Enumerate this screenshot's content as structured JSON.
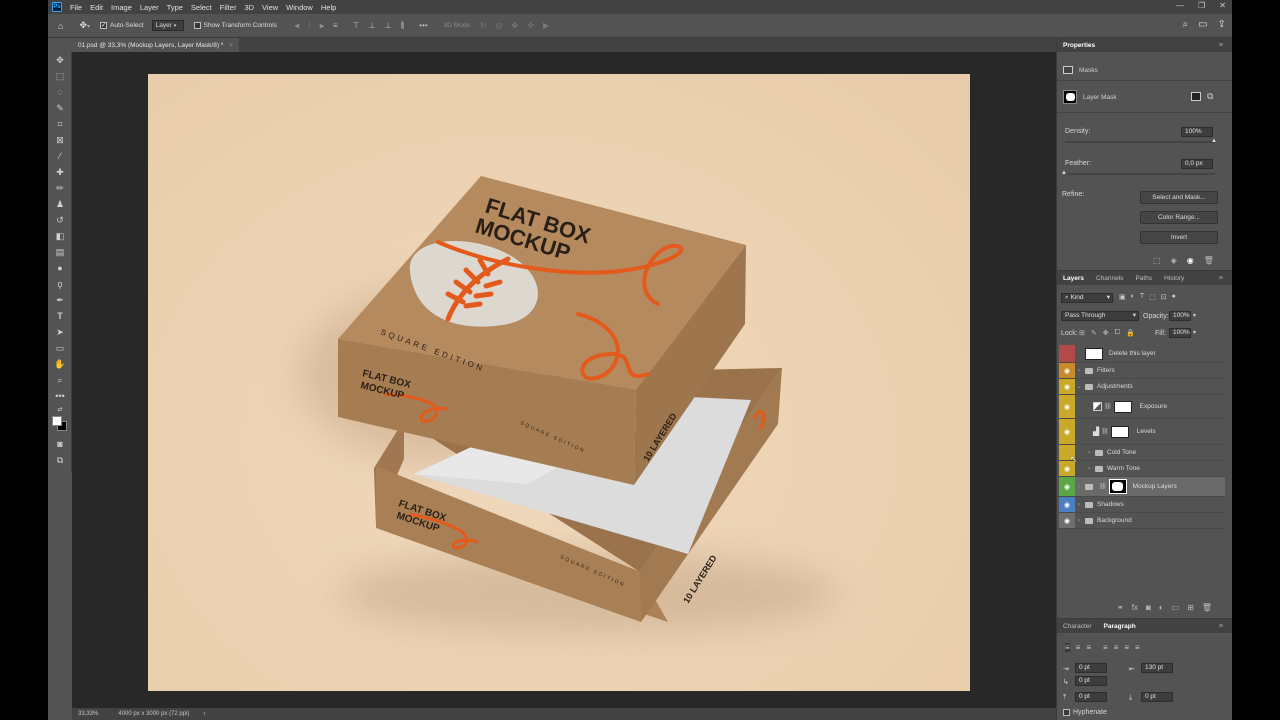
{
  "menubar": {
    "logo": "Ps",
    "items": [
      "File",
      "Edit",
      "Image",
      "Layer",
      "Type",
      "Select",
      "Filter",
      "3D",
      "View",
      "Window",
      "Help"
    ],
    "window_controls": [
      "—",
      "❐",
      "✕"
    ]
  },
  "options_bar": {
    "auto_select_label": "Auto-Select",
    "auto_select_checked": true,
    "target_value": "Layer",
    "show_transform_label": "Show Transform Controls",
    "mode_3d_label": "3D Mode:"
  },
  "document": {
    "tab_title": "01.psd @ 33,3% (Mockup Layers, Layer Mask/8) *",
    "close_glyph": "×"
  },
  "status": {
    "zoom": "33,33%",
    "doc_size": "4000 px x 3000 px (72 ppi)"
  },
  "box_art": {
    "title_line1": "FLAT BOX",
    "title_line2": "MOCKUP",
    "edition": "SQUARE EDITION",
    "side_text": "10 LAYERED"
  },
  "properties": {
    "tab": "Properties",
    "section": "Masks",
    "mask_label": "Layer Mask",
    "density_label": "Density:",
    "density_value": "100%",
    "feather_label": "Feather:",
    "feather_value": "0,0 px",
    "refine_label": "Refine:",
    "btn_select_mask": "Select and Mask...",
    "btn_color_range": "Color Range...",
    "btn_invert": "Invert",
    "density_fraction": 1.0,
    "feather_fraction": 0.0
  },
  "layers_panel": {
    "tabs": [
      "Layers",
      "Channels",
      "Paths",
      "History"
    ],
    "filter_kind": "Kind",
    "blend_mode": "Pass Through",
    "opacity_label": "Opacity:",
    "opacity_value": "100%",
    "lock_label": "Lock:",
    "fill_label": "Fill:",
    "fill_value": "100%",
    "layers": [
      {
        "name": "Delete this layer",
        "color": "#b34a4a",
        "visible": false,
        "type": "thumb"
      },
      {
        "name": "Filters",
        "color": "#c98a2a",
        "visible": true,
        "type": "group",
        "open": false
      },
      {
        "name": "Adjustments",
        "color": "#c9a82a",
        "visible": true,
        "type": "group",
        "open": true
      },
      {
        "name": "Exposure",
        "color": "#c9a82a",
        "visible": true,
        "type": "adjust"
      },
      {
        "name": "Levels",
        "color": "#c9a82a",
        "visible": true,
        "type": "adjust"
      },
      {
        "name": "Cold Tone",
        "color": "#c9a82a",
        "visible": false,
        "type": "subgroup"
      },
      {
        "name": "Warm Tone",
        "color": "#c9a82a",
        "visible": true,
        "type": "subgroup"
      },
      {
        "name": "Mockup Layers",
        "color": "#5aa845",
        "visible": true,
        "type": "masked-group",
        "selected": true
      },
      {
        "name": "Shadows",
        "color": "#4a7fc1",
        "visible": true,
        "type": "group"
      },
      {
        "name": "Background",
        "color": "#6e6e6e",
        "visible": true,
        "type": "group"
      }
    ]
  },
  "char_panel": {
    "tabs": [
      "Character",
      "Paragraph"
    ],
    "indent_left": "0 pt",
    "indent_right": "130 pt",
    "first_line": "0 pt",
    "space_before": "0 pt",
    "space_after": "0 pt",
    "hyphenate_label": "Hyphenate"
  }
}
